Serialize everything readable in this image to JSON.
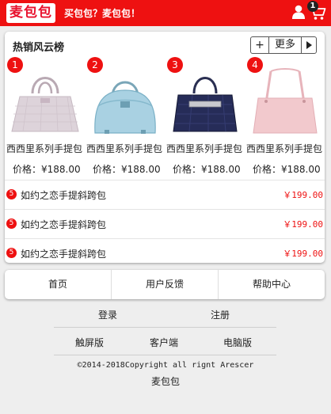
{
  "header": {
    "logo_text": "麦包包",
    "slogan": "买包包？麦包包！",
    "cart_count": "1",
    "colors": {
      "brand_red": "#ee1111"
    }
  },
  "hot": {
    "title": "热销风云榜",
    "plus_label": "+",
    "more_label": "更多",
    "products": [
      {
        "rank": "1",
        "name": "西西里系列手提包",
        "price": "价格：¥188.00",
        "icon": "handbag-lilac-icon"
      },
      {
        "rank": "2",
        "name": "西西里系列手提包",
        "price": "价格：¥188.00",
        "icon": "handbag-blue-icon"
      },
      {
        "rank": "3",
        "name": "西西里系列手提包",
        "price": "价格：¥188.00",
        "icon": "handbag-navy-icon"
      },
      {
        "rank": "4",
        "name": "西西里系列手提包",
        "price": "价格：¥188.00",
        "icon": "handbag-pink-icon"
      }
    ],
    "list": [
      {
        "rank": "5",
        "title": "如约之恋手提斜跨包",
        "price": "￥199.00"
      },
      {
        "rank": "5",
        "title": "如约之恋手提斜跨包",
        "price": "￥199.00"
      },
      {
        "rank": "5",
        "title": "如约之恋手提斜跨包",
        "price": "￥199.00"
      }
    ]
  },
  "nav": {
    "home": "首页",
    "feedback": "用户反馈",
    "help": "帮助中心"
  },
  "footer": {
    "login": "登录",
    "register": "注册",
    "touch": "触屏版",
    "client": "客户端",
    "pc": "电脑版",
    "copyright": "©2014-2018Copyright all rignt Arescer",
    "brand": "麦包包"
  }
}
